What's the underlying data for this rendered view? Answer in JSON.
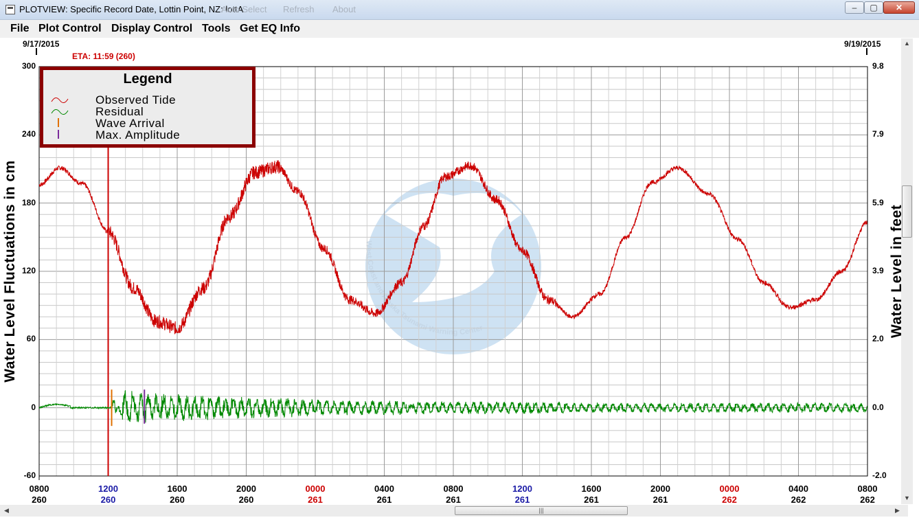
{
  "window": {
    "title": "PLOTVIEW: Specific Record Date, Lottin Point, NZ: lottA",
    "ghost_menu": [
      "Auto Select",
      "Refresh",
      "About"
    ],
    "controls": {
      "minimize": "–",
      "maximize": "▢",
      "close": "✕"
    }
  },
  "menu": [
    "File",
    "Plot Control",
    "Display Control",
    "Tools",
    "Get EQ Info"
  ],
  "dates": {
    "start": "9/17/2015",
    "end": "9/19/2015"
  },
  "eta_label": "ETA: 11:59 (260)",
  "y_axis_left": {
    "label": "Water Level Fluctuations in cm",
    "ticks": [
      "300",
      "240",
      "180",
      "120",
      "60",
      "0",
      "-60"
    ]
  },
  "y_axis_right": {
    "label": "Water Level in feet",
    "ticks": [
      "9.8",
      "7.9",
      "5.9",
      "3.9",
      "2.0",
      "0.0",
      "-2.0"
    ]
  },
  "x_ticks": [
    {
      "time": "0800",
      "day": "260",
      "color": "#000000"
    },
    {
      "time": "1200",
      "day": "260",
      "color": "#1a1aa6"
    },
    {
      "time": "1600",
      "day": "260",
      "color": "#000000"
    },
    {
      "time": "2000",
      "day": "260",
      "color": "#000000"
    },
    {
      "time": "0000",
      "day": "261",
      "color": "#cc0000"
    },
    {
      "time": "0400",
      "day": "261",
      "color": "#000000"
    },
    {
      "time": "0800",
      "day": "261",
      "color": "#000000"
    },
    {
      "time": "1200",
      "day": "261",
      "color": "#1a1aa6"
    },
    {
      "time": "1600",
      "day": "261",
      "color": "#000000"
    },
    {
      "time": "2000",
      "day": "261",
      "color": "#000000"
    },
    {
      "time": "0000",
      "day": "262",
      "color": "#cc0000"
    },
    {
      "time": "0400",
      "day": "262",
      "color": "#000000"
    },
    {
      "time": "0800",
      "day": "262",
      "color": "#000000"
    }
  ],
  "legend": {
    "title": "Legend",
    "items": [
      {
        "label": "Observed Tide",
        "color": "#cc0000",
        "icon": "wave-icon"
      },
      {
        "label": "Residual",
        "color": "#008800",
        "icon": "wave-icon"
      },
      {
        "label": "Wave Arrival",
        "color": "#e07000",
        "icon": "bar-icon"
      },
      {
        "label": "Max. Amplitude",
        "color": "#7a2a9a",
        "icon": "bar-icon"
      }
    ]
  },
  "watermark_text": "West Coast and Alaska Tsunami Warning Center",
  "chart_data": {
    "type": "line",
    "x_unit": "hours since 0800 day 260",
    "xlim": [
      0,
      48
    ],
    "ylim": [
      -60,
      300
    ],
    "y2lim": [
      -2.0,
      9.8
    ],
    "eta_hour": 4.0,
    "wave_arrival_hour": 4.2,
    "max_amplitude_hour": 6.1,
    "series": [
      {
        "name": "Observed Tide",
        "color": "#cc0000",
        "x": [
          0,
          1.2,
          2.5,
          4.0,
          5.5,
          6.8,
          8.0,
          9.5,
          11.0,
          12.5,
          13.8,
          15.0,
          16.5,
          18.0,
          19.5,
          21.0,
          22.3,
          23.5,
          25.0,
          26.5,
          28.0,
          29.5,
          30.9,
          32.5,
          34.0,
          35.5,
          37.0,
          38.8,
          40.5,
          42.0,
          43.5,
          45.0,
          46.5,
          48.0
        ],
        "y": [
          196,
          211,
          197,
          155,
          105,
          76,
          70,
          105,
          168,
          207,
          212,
          190,
          140,
          95,
          83,
          110,
          160,
          203,
          213,
          183,
          138,
          95,
          80,
          100,
          150,
          198,
          211,
          188,
          148,
          110,
          88,
          95,
          120,
          163
        ]
      },
      {
        "name": "Residual",
        "color": "#008800",
        "x": [
          0,
          1,
          2,
          3,
          4,
          4.2,
          5,
          6,
          7,
          8,
          10,
          12,
          14,
          16,
          18,
          20,
          24,
          28,
          32,
          36,
          40,
          44,
          48
        ],
        "y": [
          2,
          3,
          0,
          0,
          0,
          -10,
          14,
          13,
          12,
          11,
          10,
          9,
          8,
          7,
          6,
          6,
          5,
          5,
          4,
          4,
          4,
          4,
          4
        ]
      }
    ]
  }
}
